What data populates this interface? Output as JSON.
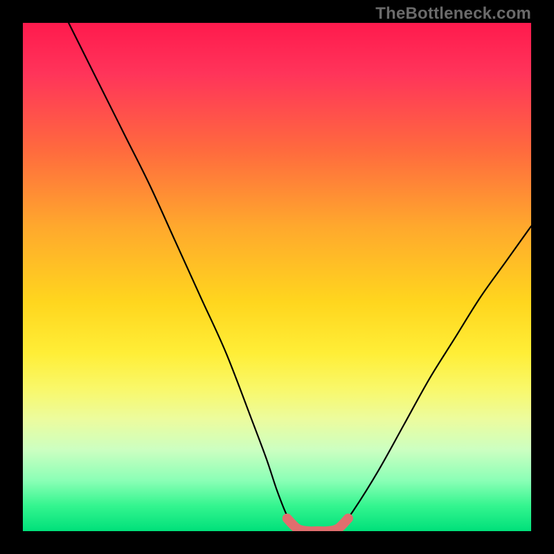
{
  "watermark": {
    "text": "TheBottleneck.com"
  },
  "colors": {
    "background": "#000000",
    "curve_main": "#000000",
    "curve_highlight": "#e06e6e",
    "gradient_top": "#ff1a4d",
    "gradient_bottom": "#00e07a"
  },
  "chart_data": {
    "type": "line",
    "title": "",
    "xlabel": "",
    "ylabel": "",
    "xlim": [
      0,
      100
    ],
    "ylim": [
      0,
      100
    ],
    "grid": false,
    "series": [
      {
        "name": "left-branch",
        "x": [
          9,
          15,
          20,
          25,
          30,
          35,
          40,
          45,
          48,
          50,
          52,
          54
        ],
        "y": [
          100,
          88,
          78,
          68,
          57,
          46,
          35,
          22,
          14,
          8,
          3,
          0
        ]
      },
      {
        "name": "flat-bottom",
        "x": [
          54,
          56,
          58,
          60,
          62
        ],
        "y": [
          0,
          0,
          0,
          0,
          0
        ]
      },
      {
        "name": "right-branch",
        "x": [
          62,
          65,
          70,
          75,
          80,
          85,
          90,
          95,
          100
        ],
        "y": [
          0,
          4,
          12,
          21,
          30,
          38,
          46,
          53,
          60
        ]
      }
    ],
    "highlight": {
      "name": "bottom-highlight",
      "x": [
        52,
        54,
        56,
        58,
        60,
        62,
        64
      ],
      "y": [
        2.5,
        0.5,
        0,
        0,
        0,
        0.5,
        2.5
      ]
    }
  }
}
